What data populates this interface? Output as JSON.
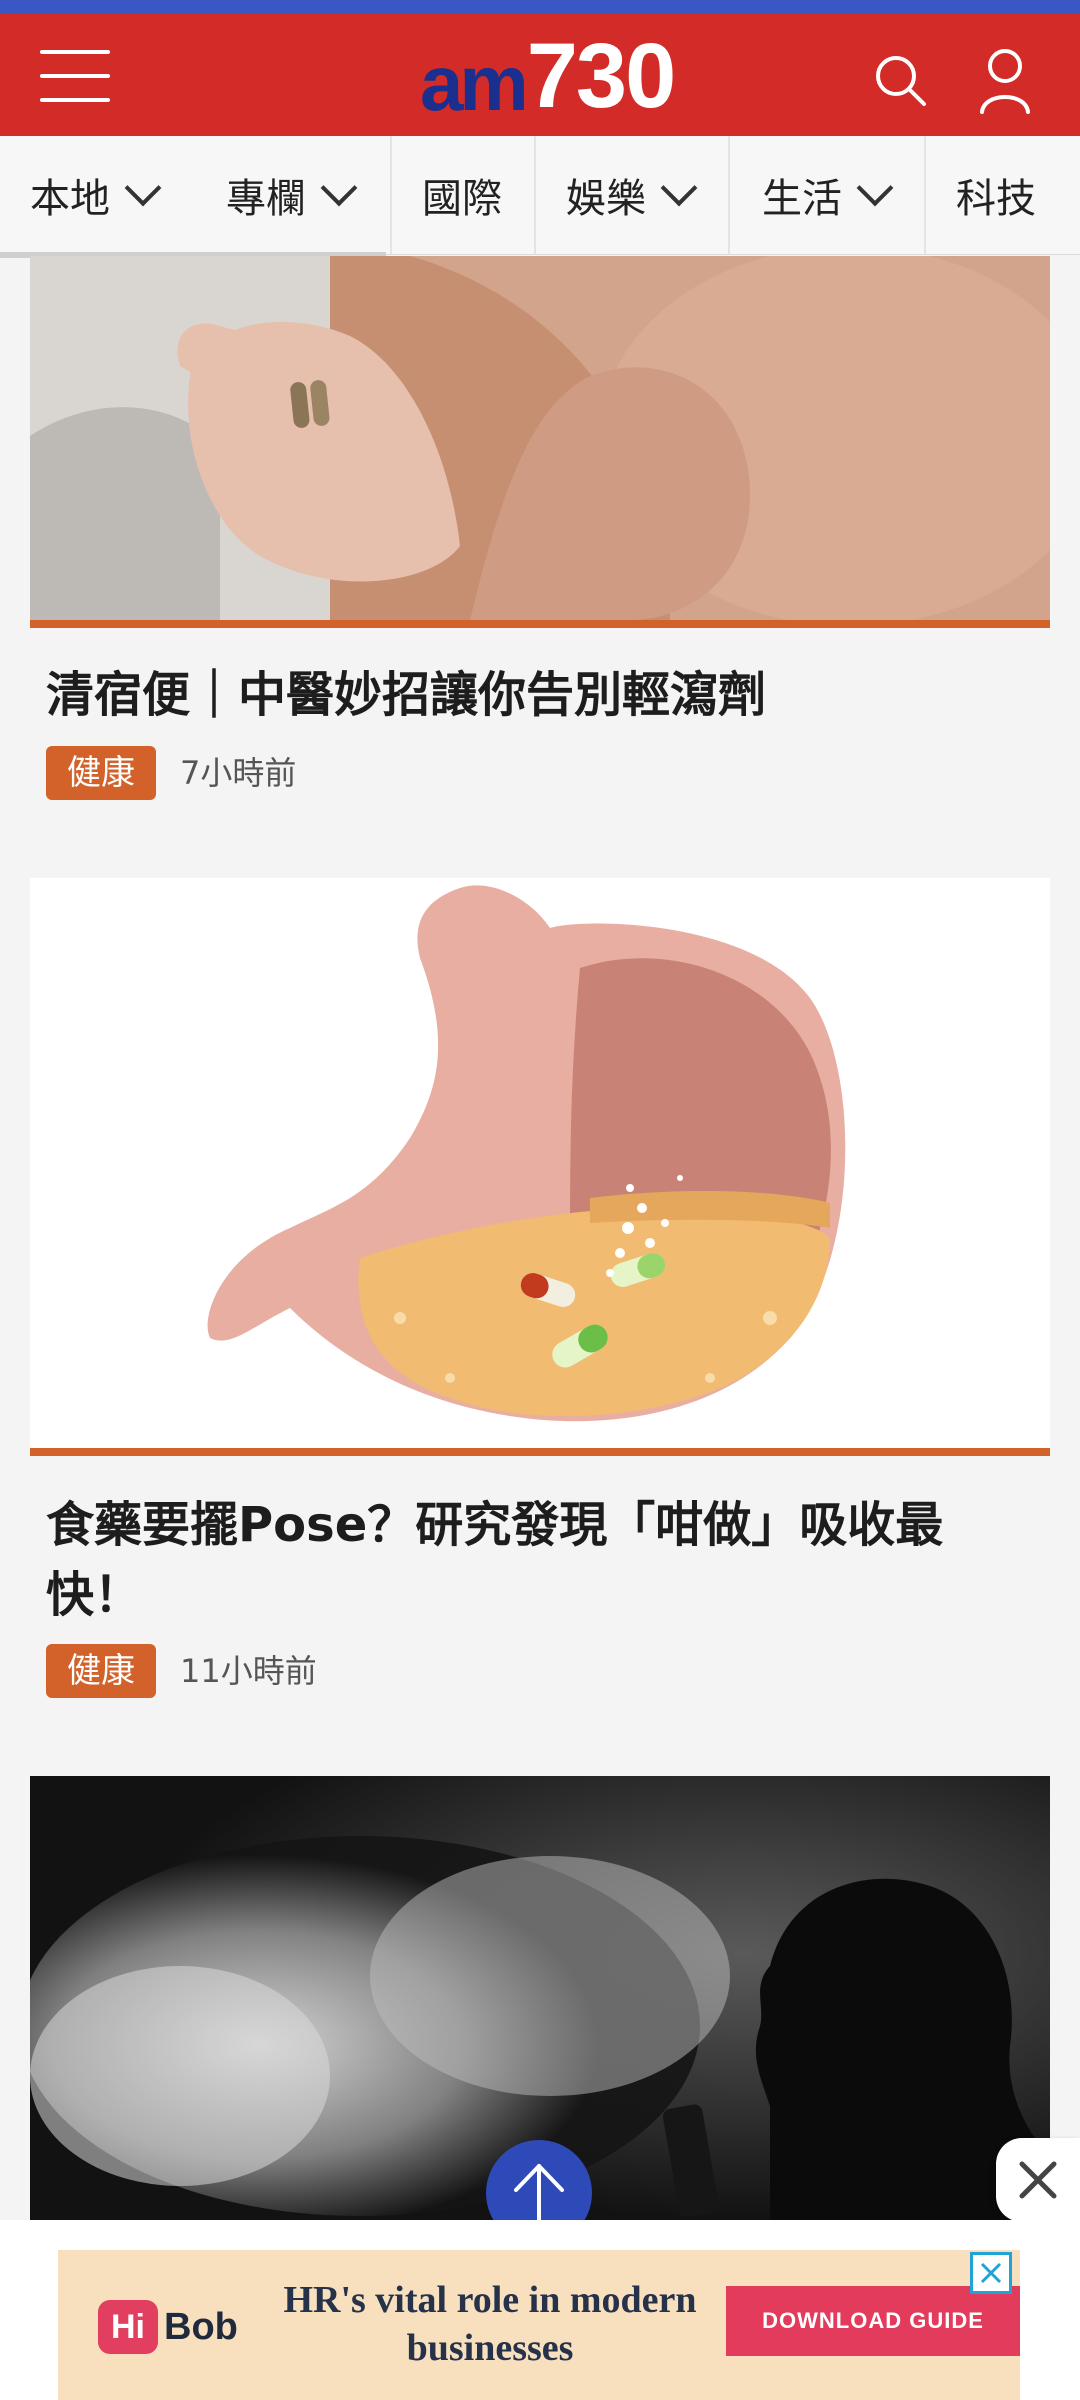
{
  "header": {
    "logo_am": "am",
    "logo_num": "730",
    "icons": [
      "hamburger-menu-icon",
      "search-icon",
      "user-icon"
    ],
    "brand_color": "#d32b27",
    "logo_color": "#1a2f8e"
  },
  "nav": {
    "items": [
      {
        "label": "本地",
        "dropdown": true
      },
      {
        "label": "專欄",
        "dropdown": true
      },
      {
        "label": "國際",
        "dropdown": false
      },
      {
        "label": "娛樂",
        "dropdown": true
      },
      {
        "label": "生活",
        "dropdown": true
      },
      {
        "label": "科技",
        "dropdown": false
      }
    ]
  },
  "articles": [
    {
      "title": "清宿便｜中醫妙招讓你告別輕瀉劑",
      "tag": "健康",
      "time": "7小時前"
    },
    {
      "title": "食藥要擺Pose？研究發現「咁做」吸收最快！",
      "tag": "健康",
      "time": "11小時前"
    },
    {
      "title": "",
      "tag": "",
      "time": ""
    }
  ],
  "accent_color": "#d2622a",
  "ad": {
    "brand_hi": "Hi",
    "brand_bob": "Bob",
    "headline": "HR's vital role in modern businesses",
    "cta": "DOWNLOAD GUIDE"
  }
}
